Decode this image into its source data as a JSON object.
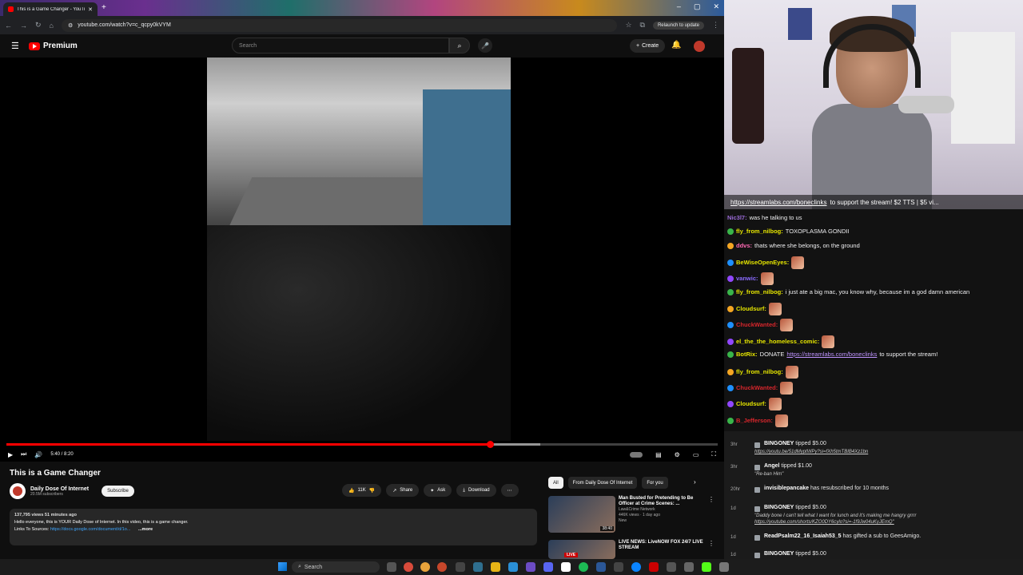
{
  "browser": {
    "tab_title": "This is a Game Changer - YouTube",
    "url": "youtube.com/watch?v=c_qcpy0kVYM",
    "relaunch": "Relaunch to update"
  },
  "youtube": {
    "logo": "Premium",
    "search_placeholder": "Search",
    "create": "Create",
    "player": {
      "time": "5:40 / 8:20",
      "progress_fraction": 0.68,
      "buffered_fraction": 0.75
    },
    "video_title": "This is a Game Changer",
    "channel": {
      "name": "Daily Dose Of Internet",
      "subs": "20.5M subscribers",
      "subscribe": "Subscribe"
    },
    "actions": {
      "likes": "11K",
      "share": "Share",
      "ask": "Ask",
      "download": "Download"
    },
    "description": {
      "meta": "137,795 views  51 minutes ago",
      "line1": "Hello everyone, this is YOUR Daily Dose of Internet. In this video, this is a game changer.",
      "links_label": "Links To Sources:",
      "link": "https://docs.google.com/document/d/1o...",
      "more": "...more"
    },
    "chips": [
      "All",
      "From Daily Dose Of Internet",
      "For you"
    ],
    "recs": [
      {
        "title": "Man Busted for Pretending to Be Officer at Crime Scenes: ...",
        "channel": "Law&Crime Network",
        "meta": "446K views · 1 day ago",
        "badge": "New",
        "duration": "38:40"
      },
      {
        "title": "LIVE NEWS: LiveNOW FOX 24/7 LIVE STREAM",
        "channel": "",
        "meta": "",
        "badge": "",
        "live": "LIVE"
      }
    ]
  },
  "stream": {
    "ticker_link": "https://streamlabs.com/boneclinks",
    "ticker_text": "to support the stream! $2 TTS | $5 vi..."
  },
  "chat": [
    {
      "user": "Nic3l7:",
      "color": "#9b6bd8",
      "text": "was he talking to us"
    },
    {
      "user": "fly_from_nilbog:",
      "color": "#e6e600",
      "text": "TOXOPLASMA GONDII"
    },
    {
      "user": "ddvs:",
      "color": "#ff69b4",
      "text": "thats where she belongs, on the ground"
    },
    {
      "user": "BeWiseOpenEyes:",
      "color": "#e6e600",
      "text": ""
    },
    {
      "user": "vanwic:",
      "color": "#8a6bff",
      "text": ""
    },
    {
      "user": "fly_from_nilbog:",
      "color": "#e6e600",
      "text": "i just ate a big mac, you know why, because im a god damn american"
    },
    {
      "user": "Cloudsurf:",
      "color": "#e6e600",
      "text": ""
    },
    {
      "user": "ChuckWanted:",
      "color": "#d8262c",
      "text": ""
    },
    {
      "user": "el_the_the_homeless_comic:",
      "color": "#e6e600",
      "text": ""
    },
    {
      "user": "BotRix:",
      "color": "#e6e600",
      "text": "DONATE",
      "link": "https://streamlabs.com/boneclinks",
      "after": "to support the stream!"
    },
    {
      "user": "fly_from_nilbog:",
      "color": "#e6e600",
      "text": ""
    },
    {
      "user": "ChuckWanted:",
      "color": "#d8262c",
      "text": ""
    },
    {
      "user": "Cloudsurf:",
      "color": "#e6e600",
      "text": ""
    },
    {
      "user": "B_Jefferson:",
      "color": "#d8262c",
      "text": ""
    }
  ],
  "events": [
    {
      "ago": "3hr",
      "main_user": "BINGONEY",
      "main_text": "tipped $5.00",
      "sub": "https://youtu.be/51dMyptWPy?si=fXh5tmTBIB4Xz1bn",
      "sub_url": true
    },
    {
      "ago": "3hr",
      "main_user": "Angel",
      "main_text": "tipped $1.00",
      "sub": "\"Re-ban Him\"",
      "sub_url": false
    },
    {
      "ago": "20hr",
      "main_user": "invisiblepancake",
      "main_text": "has resubscribed for 10 months",
      "sub": "",
      "sub_url": false
    },
    {
      "ago": "1d",
      "main_user": "BINGONEY",
      "main_text": "tipped $5.00",
      "sub": "\"Daddy bone I can't tell what I want for lunch and it's making me hangry grrrr",
      "sub2": "https://youtube.com/shorts/KZO0DY6cylo?si=-1f9Jw04uKyJEmQ\"",
      "sub_url": false
    },
    {
      "ago": "1d",
      "main_user": "ReadPsalm22_16_Isaiah53_5",
      "main_text": "has gifted a sub to GeesAmigo.",
      "sub": "",
      "sub_url": false
    },
    {
      "ago": "1d",
      "main_user": "BINGONEY",
      "main_text": "tipped $5.00",
      "sub": "https://youtu.be/b7olX8DU02U?si=NaUDpBfCGHsnZvAz",
      "sub_url": true
    },
    {
      "ago": "",
      "main_user": "BINGONEY",
      "main_text": "tipped $5.00",
      "sub": "",
      "sub_url": false
    }
  ],
  "taskbar": {
    "search": "Search"
  }
}
